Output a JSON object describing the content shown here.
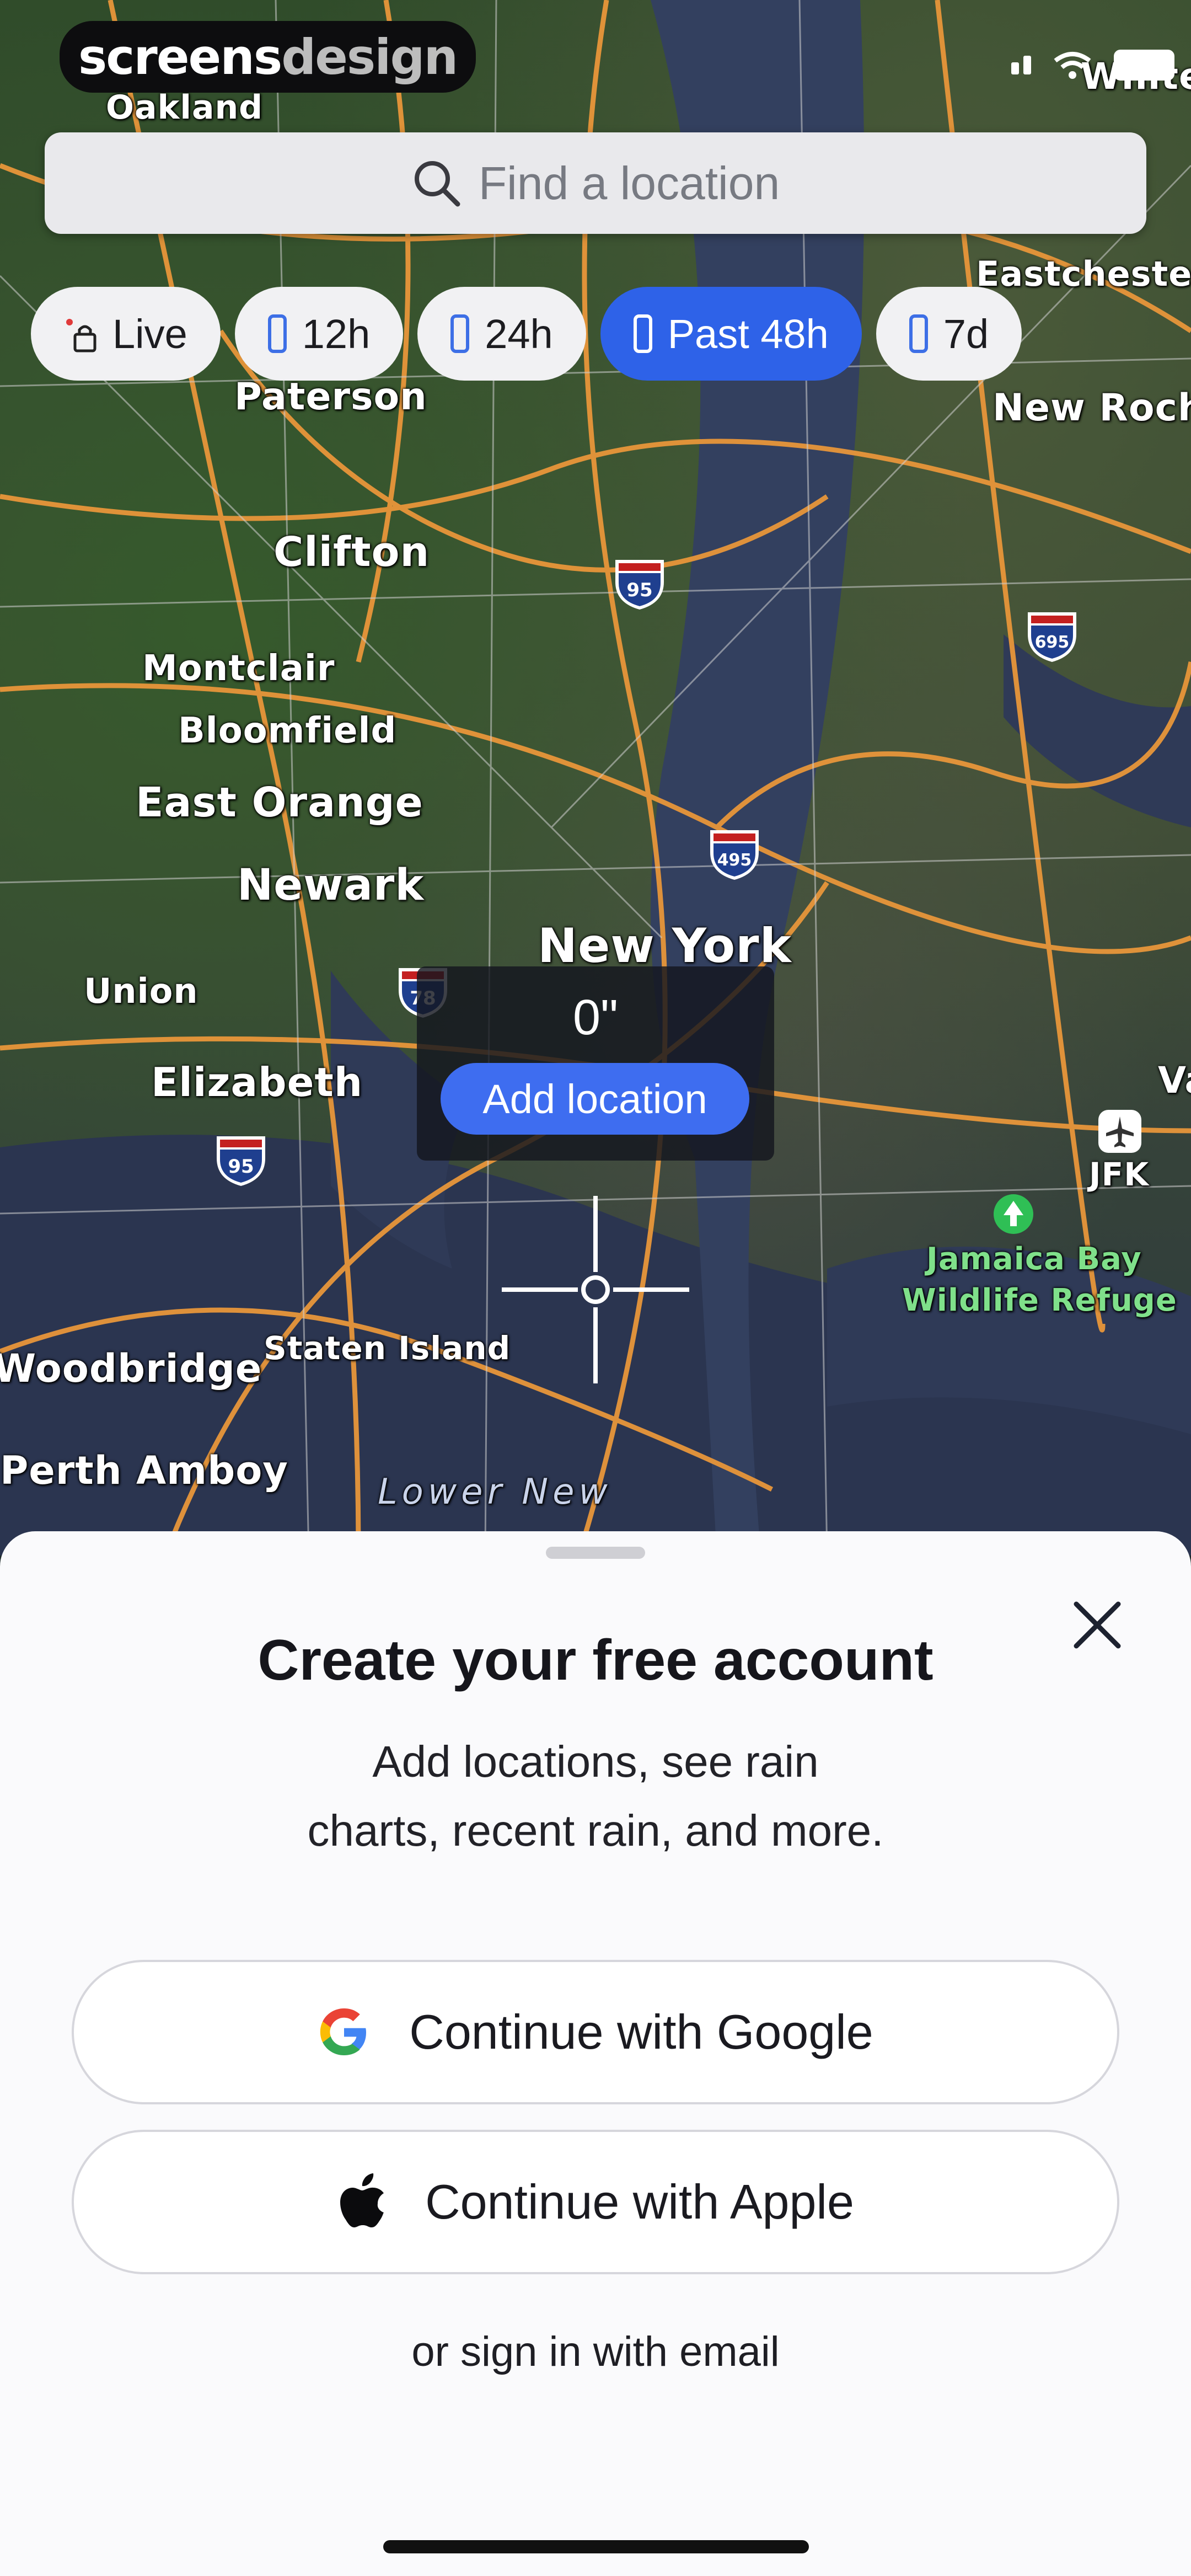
{
  "status": {
    "brand_part1": "screens",
    "brand_part2": "design"
  },
  "search": {
    "placeholder": "Find a location"
  },
  "chips": [
    {
      "label": "Live",
      "icon": "lock-icon",
      "active": false
    },
    {
      "label": "12h",
      "icon": "phone-icon",
      "active": false
    },
    {
      "label": "24h",
      "icon": "phone-icon",
      "active": false
    },
    {
      "label": "Past 48h",
      "icon": "phone-icon",
      "active": true
    },
    {
      "label": "7d",
      "icon": "phone-icon",
      "active": false
    }
  ],
  "map": {
    "labels": [
      "Oakland",
      "White P",
      "Eastchester",
      "Paterson",
      "New Roche",
      "Clifton",
      "Montclair",
      "Bloomfield",
      "East Orange",
      "Newark",
      "New York",
      "Union",
      "Elizabeth",
      "Va",
      "JFK",
      "Jamaica Bay",
      "Wildlife Refuge",
      "Staten Island",
      "Woodbridge",
      "Perth Amboy",
      "Lower New"
    ],
    "shields": [
      "95",
      "695",
      "495",
      "78",
      "95"
    ]
  },
  "tooltip": {
    "value": "0\"",
    "button_label": "Add location"
  },
  "sheet": {
    "title": "Create your free account",
    "subtitle_line1": "Add locations, see rain",
    "subtitle_line2": "charts, recent rain, and more.",
    "google_label": "Continue with Google",
    "apple_label": "Continue with Apple",
    "email_link": "or sign in with email"
  },
  "colors": {
    "accent": "#2e62e8",
    "road": "#e8963a",
    "sheet_bg": "#fafafc"
  }
}
